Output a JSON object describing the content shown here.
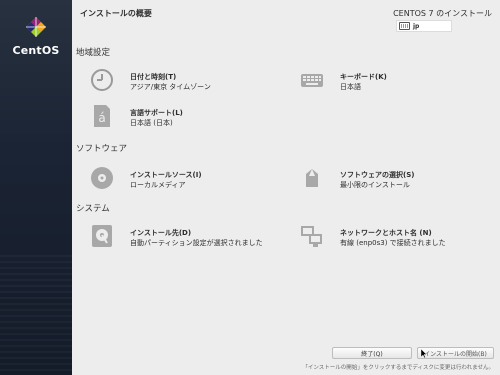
{
  "sidebar": {
    "logo_text": "CentOS"
  },
  "header": {
    "hub_title": "インストールの概要",
    "product_title": "CENTOS 7 のインストール",
    "keyboard_layout": "jp"
  },
  "sections": [
    {
      "title": "地域設定"
    },
    {
      "title": "ソフトウェア"
    },
    {
      "title": "システム"
    }
  ],
  "spokes": {
    "datetime": {
      "title": "日付と時刻(T)",
      "status": "アジア/東京 タイムゾーン",
      "icon": "clock-icon"
    },
    "keyboard": {
      "title": "キーボード(K)",
      "status": "日本語",
      "icon": "keyboard-icon"
    },
    "language": {
      "title": "言語サポート(L)",
      "status": "日本語 (日本)",
      "icon": "language-icon"
    },
    "source": {
      "title": "インストールソース(I)",
      "status": "ローカルメディア",
      "icon": "disc-icon"
    },
    "software": {
      "title": "ソフトウェアの選択(S)",
      "status": "最小限のインストール",
      "icon": "package-icon"
    },
    "destination": {
      "title": "インストール先(D)",
      "status": "自動パーティション設定が選択されました",
      "icon": "harddisk-icon"
    },
    "network": {
      "title": "ネットワークとホスト名 (N)",
      "status": "有線 (enp0s3) で接続されました",
      "icon": "network-icon"
    }
  },
  "footer": {
    "quit_label": "終了(Q)",
    "begin_label": "インストールの開始(B)",
    "note": "「インストールの開始」をクリックするまでディスクに変更は行われません。"
  }
}
